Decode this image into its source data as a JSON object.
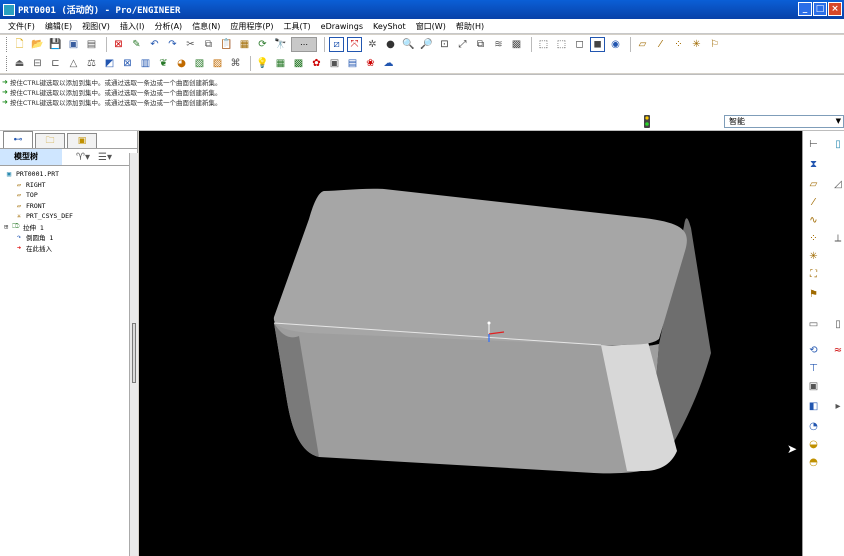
{
  "window": {
    "title": "PRT0001 (活动的) - Pro/ENGINEER"
  },
  "menu": [
    "文件(F)",
    "编辑(E)",
    "视图(V)",
    "插入(I)",
    "分析(A)",
    "信息(N)",
    "应用程序(P)",
    "工具(T)",
    "eDrawings",
    "KeyShot",
    "窗口(W)",
    "帮助(H)"
  ],
  "toolbar1": [
    "new-file-icon",
    "open-file-icon",
    "save-icon",
    "save-as-icon",
    "close-window-icon",
    "regenerate-icon",
    "undo-icon",
    "redo-icon",
    "cut-icon",
    "copy-icon",
    "paste-icon",
    "paste-special-icon",
    "repaint-icon",
    "find-icon",
    "selection-filter-icon",
    "datum-plane-display-icon",
    "datum-axis-display-icon",
    "datum-point-display-icon",
    "shading-icon",
    "zoom-in-icon",
    "zoom-out-icon",
    "refit-icon",
    "reorient-icon",
    "saved-views-icon",
    "layers-icon",
    "wireframe-icon",
    "hidden-line-icon",
    "no-hidden-icon",
    "shaded-icon",
    "enhanced-realism-icon",
    "plane-icon",
    "axis-icon",
    "point-icon",
    "csys-icon",
    "annotation-icon"
  ],
  "toolbar2": [
    "render-icon",
    "section-icon",
    "measure-icon",
    "mass-properties-icon",
    "curvature-icon",
    "draft-check-icon",
    "thickness-icon",
    "analysis-icon",
    "color-icon",
    "appearance-icon",
    "scene-icon",
    "light-icon",
    "camera-icon",
    "model-tree-icon",
    "family-table-icon",
    "relations-icon",
    "parameters-icon",
    "keyshot-render-icon",
    "keyshot-update-icon",
    "keyshot-icon"
  ],
  "messages": [
    "按住CTRL键选取以添加到集中。或通过选取一条边或一个曲面创建新集。",
    "按住CTRL键选取以添加到集中。或通过选取一条边或一个曲面创建新集。",
    "按住CTRL键选取以添加到集中。或通过选取一条边或一个曲面创建新集。"
  ],
  "filter": {
    "value": "智能"
  },
  "model_tree": {
    "title": "模型树",
    "items": [
      {
        "label": "PRT0001.PRT",
        "icon": "part-icon"
      },
      {
        "label": "RIGHT",
        "icon": "datum-plane-icon"
      },
      {
        "label": "TOP",
        "icon": "datum-plane-icon"
      },
      {
        "label": "FRONT",
        "icon": "datum-plane-icon"
      },
      {
        "label": "PRT_CSYS_DEF",
        "icon": "csys-icon"
      },
      {
        "label": "拉伸 1",
        "icon": "extrude-icon"
      },
      {
        "label": "倒圆角 1",
        "icon": "round-icon"
      },
      {
        "label": "在此插入",
        "icon": "insert-here-icon"
      }
    ]
  },
  "colors": {
    "viewport_bg": "#000000",
    "model_top": "#a4a4a4",
    "model_front": "#9c9c9c",
    "model_side": "#6e6e6e",
    "highlight": "#cfe6ff"
  }
}
